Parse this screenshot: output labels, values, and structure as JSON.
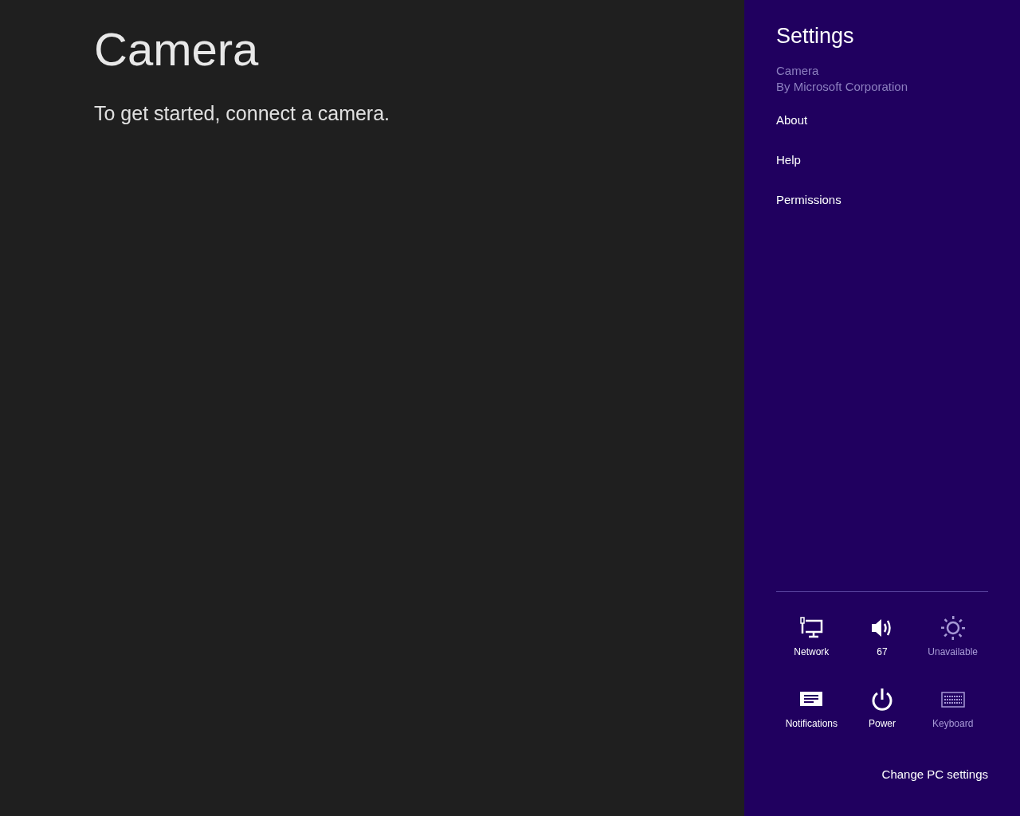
{
  "app": {
    "title": "Camera",
    "message": "To get started, connect a camera."
  },
  "settings": {
    "title": "Settings",
    "app_name": "Camera",
    "publisher": "By Microsoft Corporation",
    "items": [
      "About",
      "Help",
      "Permissions"
    ],
    "quick_settings": [
      {
        "kind": "network",
        "label": "Network",
        "disabled": false
      },
      {
        "kind": "volume",
        "label": "67",
        "disabled": false
      },
      {
        "kind": "brightness",
        "label": "Unavailable",
        "disabled": true
      },
      {
        "kind": "notifications",
        "label": "Notifications",
        "disabled": false
      },
      {
        "kind": "power",
        "label": "Power",
        "disabled": false
      },
      {
        "kind": "keyboard",
        "label": "Keyboard",
        "disabled": true
      }
    ],
    "footer_link": "Change PC settings"
  }
}
